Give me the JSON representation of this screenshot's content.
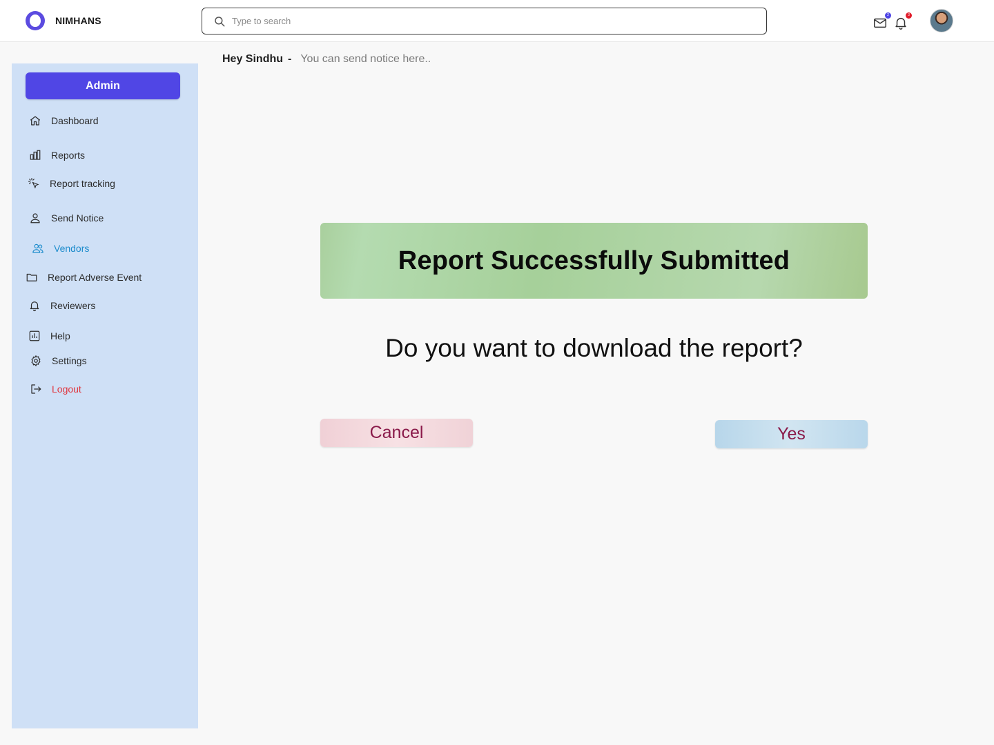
{
  "brand": {
    "name": "NIMHANS"
  },
  "search": {
    "placeholder": "Type to search"
  },
  "header": {
    "mail_badge": "2",
    "bell_badge": "3"
  },
  "greeting": {
    "name": "Hey Sindhu",
    "dash": "-",
    "message": "You can send notice  here.."
  },
  "sidebar": {
    "role_button": "Admin",
    "items": [
      {
        "label": "Dashboard",
        "icon": "home-icon"
      },
      {
        "label": "Reports",
        "icon": "bar-chart-icon"
      },
      {
        "label": "Report tracking",
        "icon": "click-cursor-icon"
      },
      {
        "label": "Send Notice",
        "icon": "user-icon"
      },
      {
        "label": "Vendors",
        "icon": "users-icon",
        "active": true
      },
      {
        "label": "Report Adverse Event",
        "icon": "folder-icon"
      },
      {
        "label": "Reviewers",
        "icon": "bell-icon"
      },
      {
        "label": "Help",
        "icon": "chart-box-icon"
      },
      {
        "label": "Settings",
        "icon": "gear-icon"
      },
      {
        "label": "Logout",
        "icon": "logout-icon"
      }
    ]
  },
  "dialog": {
    "title": "Report Successfully Submitted",
    "question": "Do you want to download the report?",
    "cancel_label": "Cancel",
    "yes_label": "Yes"
  },
  "colors": {
    "accent": "#5046e5",
    "sidebar_bg": "#cfe0f6",
    "success_banner": "#a9cf9d",
    "active_nav": "#1d8ccc",
    "logout": "#e0343c",
    "button_text": "#8a1a4a"
  }
}
